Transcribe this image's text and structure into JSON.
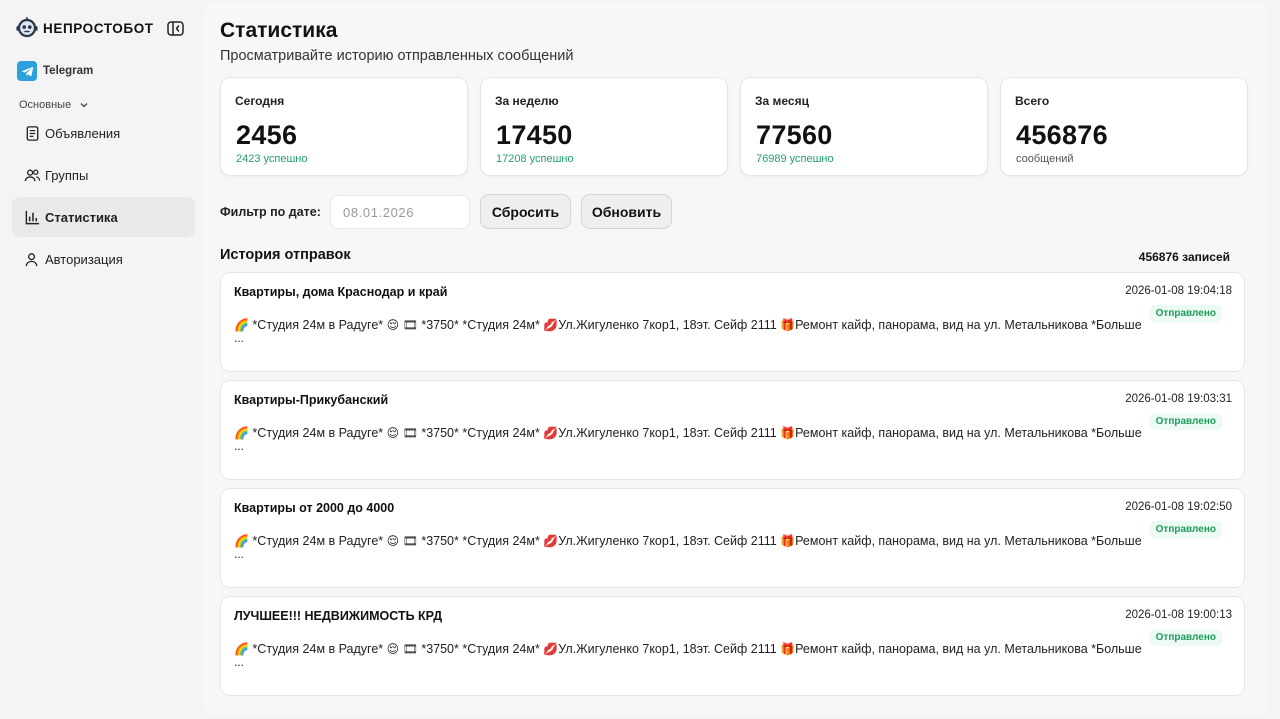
{
  "sidebar": {
    "brand": "НЕПРОСТОБОТ",
    "channel": "Telegram",
    "section": "Основные",
    "items": [
      {
        "label": "Объявления",
        "icon": "document-icon"
      },
      {
        "label": "Группы",
        "icon": "users-icon"
      },
      {
        "label": "Статистика",
        "icon": "bar-chart-icon",
        "active": true
      },
      {
        "label": "Авторизация",
        "icon": "user-icon"
      }
    ]
  },
  "header": {
    "title": "Статистика",
    "subtitle": "Просматривайте историю отправленных сообщений"
  },
  "stats": [
    {
      "title": "Сегодня",
      "value": "2456",
      "sub": "2423 успешно"
    },
    {
      "title": "За неделю",
      "value": "17450",
      "sub": "17208 успешно"
    },
    {
      "title": "За месяц",
      "value": "77560",
      "sub": "76989 успешно"
    },
    {
      "title": "Всего",
      "value": "456876",
      "sub": "сообщений"
    }
  ],
  "filter": {
    "label": "Фильтр по дате:",
    "date_value": "08.01.2026",
    "reset_label": "Сбросить",
    "refresh_label": "Обновить"
  },
  "history": {
    "title": "История отправок",
    "count": "456876 записей",
    "rows": [
      {
        "title": "Квартиры, дома Краснодар и край",
        "time": "2026-01-08 19:04:18",
        "status": "Отправлено"
      },
      {
        "title": "Квартиры-Прикубанский",
        "time": "2026-01-08 19:03:31",
        "status": "Отправлено"
      },
      {
        "title": "Квартиры от 2000 до 4000",
        "time": "2026-01-08 19:02:50",
        "status": "Отправлено"
      },
      {
        "title": "ЛУЧШЕЕ!!! НЕДВИЖИМОСТЬ КРД",
        "time": "2026-01-08 19:00:13",
        "status": "Отправлено"
      }
    ],
    "message_parts": [
      "*Студия 24м в Радуге*",
      "*3750* *Студия 24м*",
      "Ул.Жигуленко 7кор1, 18эт. Сейф 2111",
      "Ремонт кайф, панорама, вид на ул. Метальникова *Больше"
    ],
    "message_ellipsis": "..."
  },
  "colors": {
    "success": "#22a06b",
    "status_bg": "#ecfbf3",
    "telegram": "#2aa1dc",
    "active_nav": "#e9e9ec"
  }
}
